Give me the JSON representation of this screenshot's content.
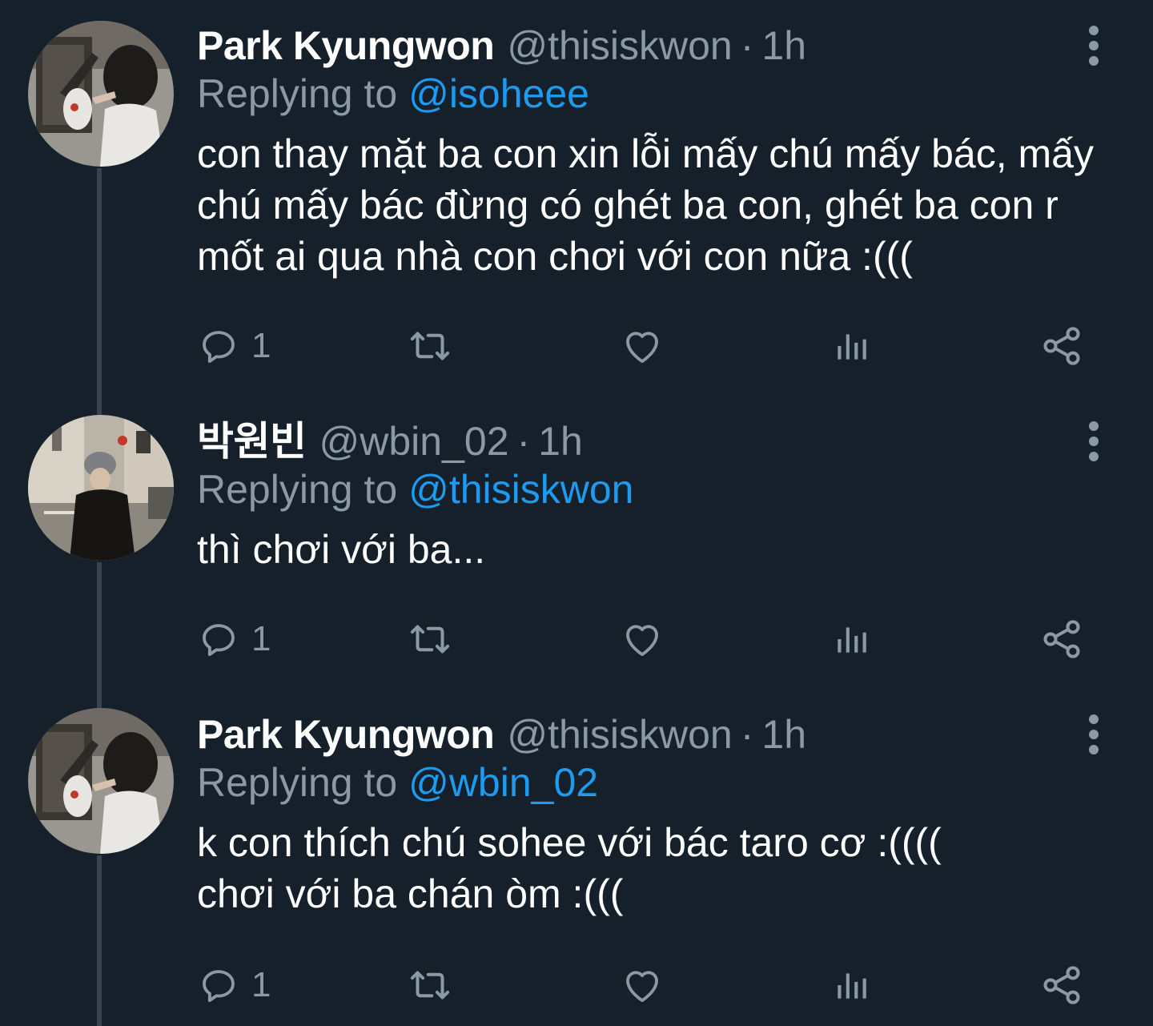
{
  "colors": {
    "background": "#15202b",
    "primary_text": "#ffffff",
    "secondary_text": "#8b98a5",
    "link": "#1d9bf0",
    "thread_line": "#38444d"
  },
  "tweets": [
    {
      "display_name": "Park Kyungwon",
      "handle": "@thisiskwon",
      "separator": "·",
      "time": "1h",
      "reply_prefix": "Replying to",
      "reply_to": "@isoheee",
      "text": "con thay mặt ba con xin lỗi mấy chú mấy bác, mấy chú mấy bác đừng có ghét ba con, ghét ba con r mốt ai qua nhà con chơi với con nữa :(((",
      "reply_count": "1",
      "icons": [
        "reply-icon",
        "retweet-icon",
        "like-icon",
        "views-icon",
        "share-icon",
        "more-icon"
      ]
    },
    {
      "display_name": "박원빈",
      "handle": "@wbin_02",
      "separator": "·",
      "time": "1h",
      "reply_prefix": "Replying to",
      "reply_to": "@thisiskwon",
      "text": "thì chơi với ba...",
      "reply_count": "1",
      "icons": [
        "reply-icon",
        "retweet-icon",
        "like-icon",
        "views-icon",
        "share-icon",
        "more-icon"
      ]
    },
    {
      "display_name": "Park Kyungwon",
      "handle": "@thisiskwon",
      "separator": "·",
      "time": "1h",
      "reply_prefix": "Replying to",
      "reply_to": "@wbin_02",
      "text": "k con thích chú sohee với bác taro cơ :(((( chơi với ba chán òm :(((",
      "reply_count": "1",
      "icons": [
        "reply-icon",
        "retweet-icon",
        "like-icon",
        "views-icon",
        "share-icon",
        "more-icon"
      ]
    }
  ]
}
